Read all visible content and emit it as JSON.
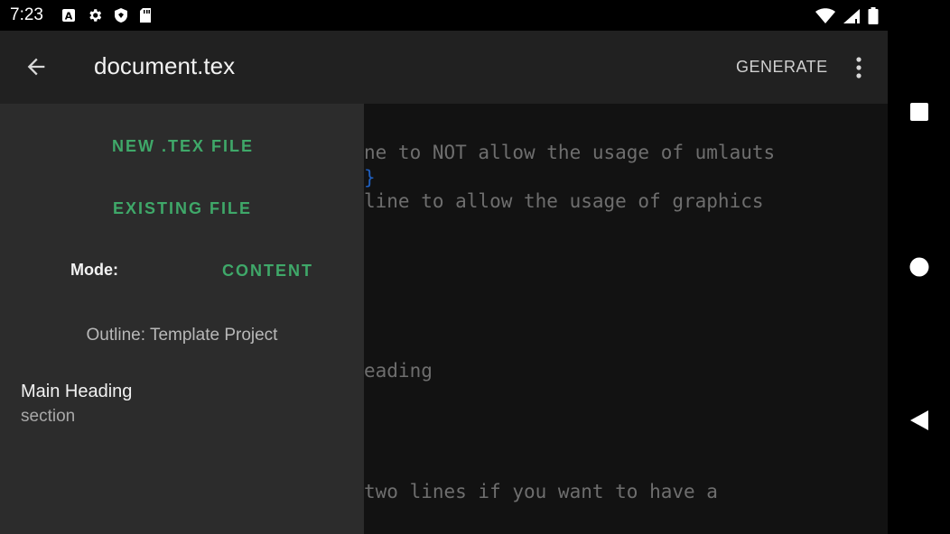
{
  "status_bar": {
    "time": "7:23",
    "left_icons": [
      "font-a-icon",
      "gear-icon",
      "shield-icon",
      "sd-card-icon"
    ],
    "right_icons": [
      "wifi-icon",
      "signal-icon",
      "battery-icon"
    ]
  },
  "app_bar": {
    "title": "document.tex",
    "generate_label": "GENERATE",
    "back_icon": "arrow-left-icon",
    "overflow_icon": "more-vert-icon"
  },
  "editor": {
    "lines": [
      {
        "text": "ne to NOT allow the usage of umlauts",
        "color": "#6e6e6e"
      },
      {
        "text": "}",
        "color": "#1f5fbf"
      },
      {
        "text": "line to allow the usage of graphics",
        "color": "#6e6e6e"
      },
      {
        "text": "eading",
        "color": "#6e6e6e"
      },
      {
        "text": "two lines if you want to have a",
        "color": "#6e6e6e"
      }
    ]
  },
  "drawer": {
    "new_file_label": "NEW .TEX FILE",
    "existing_file_label": "EXISTING FILE",
    "mode_label": "Mode:",
    "mode_value": "CONTENT",
    "outline_label": "Outline: Template Project",
    "outline_items": [
      {
        "title": "Main Heading",
        "subtitle": "section"
      }
    ]
  },
  "nav_bar": {
    "icons": [
      "recents-icon",
      "home-icon",
      "back-icon"
    ]
  },
  "colors": {
    "accent_green": "#3fa869",
    "app_bar": "#212121",
    "drawer": "#2c2c2c",
    "editor_bg": "#121212"
  }
}
